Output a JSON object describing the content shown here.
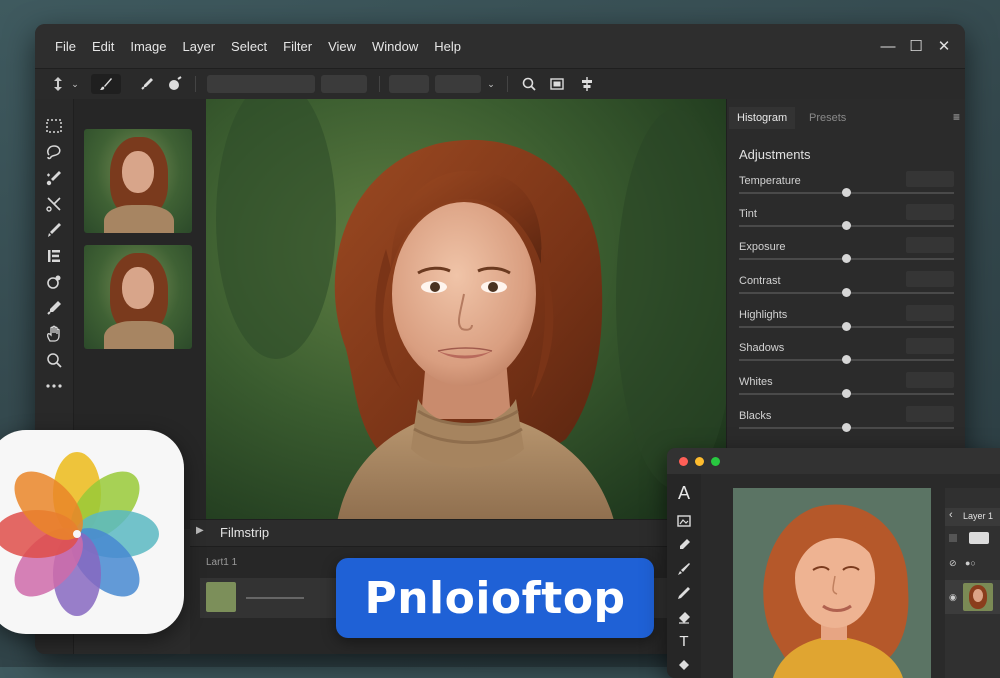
{
  "menu": {
    "items": [
      "File",
      "Edit",
      "Image",
      "Layer",
      "Select",
      "Filter",
      "View",
      "Window",
      "Help"
    ]
  },
  "window_controls": {
    "minimize": "—",
    "maximize": "☐",
    "close": "✕"
  },
  "panel": {
    "tabs": [
      {
        "label": "Histogram",
        "active": true
      },
      {
        "label": "Presets",
        "active": false
      }
    ],
    "adjustments_title": "Adjustments",
    "adjustments": [
      {
        "label": "Temperature",
        "value": 0.5
      },
      {
        "label": "Tint",
        "value": 0.5
      },
      {
        "label": "Exposure",
        "value": 0.5
      },
      {
        "label": "Contrast",
        "value": 0.5
      },
      {
        "label": "Highlights",
        "value": 0.5
      },
      {
        "label": "Shadows",
        "value": 0.5
      },
      {
        "label": "Whites",
        "value": 0.5
      },
      {
        "label": "Blacks",
        "value": 0.5
      }
    ]
  },
  "filmstrip": {
    "title": "Filmstrip",
    "layer_label": "Lart1 1"
  },
  "badge": {
    "text": "Pnloioftop"
  },
  "second_window": {
    "layers_title": "Layer 1",
    "tool_text_glyph": "A",
    "tool_type_glyph": "T"
  },
  "colors": {
    "badge_blue": "#1f61d6",
    "hair": "#8a3d1c",
    "sweater": "#a98763",
    "background_green": "#3e6130"
  }
}
